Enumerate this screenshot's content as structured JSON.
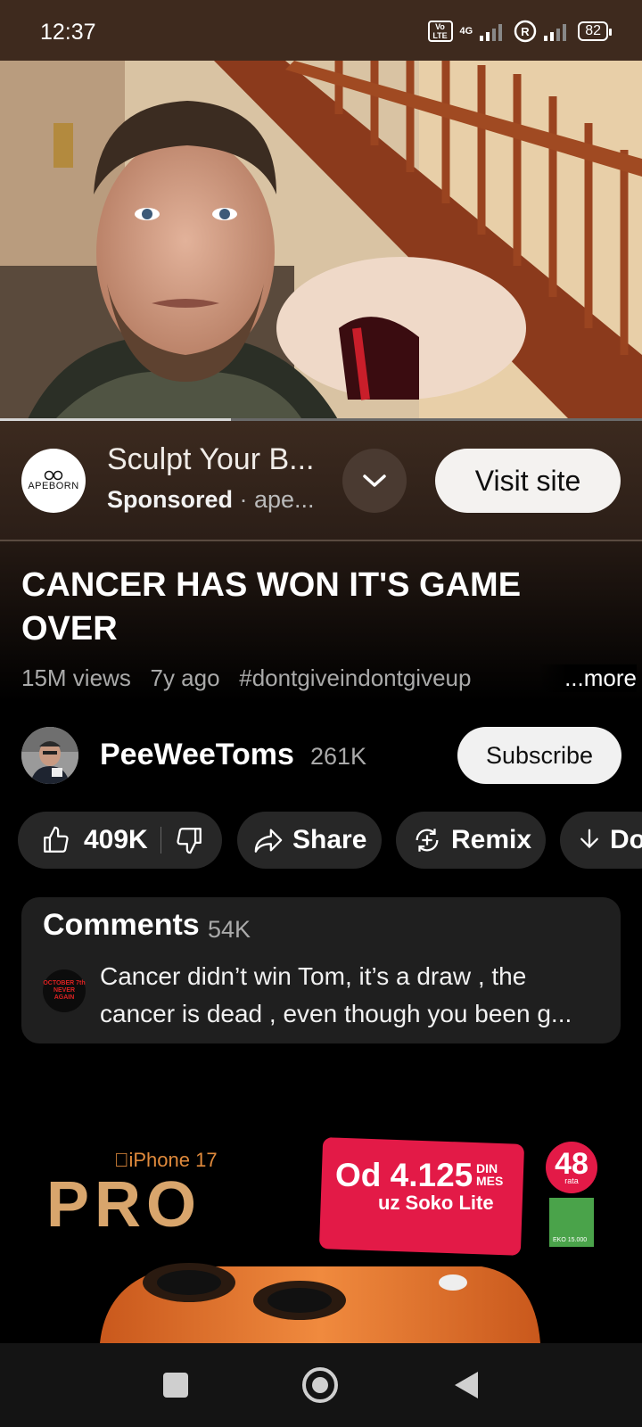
{
  "status_bar": {
    "time": "12:37",
    "volte": "Vo LTE",
    "network": "4G",
    "battery": "82"
  },
  "video": {
    "progress": 0.36
  },
  "ad": {
    "logo_text": "APEBORN",
    "title": "Sculpt Your B...",
    "sponsored": "Sponsored",
    "domain": " · ape...",
    "visit_label": "Visit site"
  },
  "title": "CANCER HAS WON IT'S GAME OVER",
  "meta": {
    "views": "15M views",
    "age": "7y ago",
    "hashtag": "#dontgiveindontgiveup",
    "more": "...more"
  },
  "channel": {
    "name": "PeeWeeToms",
    "subscribers": "261K",
    "subscribe_label": "Subscribe"
  },
  "actions": {
    "likes": "409K",
    "share": "Share",
    "remix": "Remix",
    "download": "Do"
  },
  "comments": {
    "heading": "Comments",
    "count": "54K",
    "avatar_text": "OCTOBER 7th NEVER AGAIN",
    "top_comment": "Cancer didn’t win Tom, it’s a draw , the cancer is dead , even though you been g..."
  },
  "banner": {
    "brand": "iPhone 17",
    "model": "PRO",
    "price": "Od 4.125",
    "currency": "DIN",
    "per": "MES",
    "plan": "uz Soko Lite",
    "rate_count": "48",
    "rate_label": "rata",
    "eco_text": "EKO 15.000"
  },
  "icons": [
    "like-icon",
    "dislike-icon",
    "share-icon",
    "remix-icon",
    "download-icon",
    "chevron-down-icon",
    "nav-recents-icon",
    "nav-home-icon",
    "nav-back-icon"
  ]
}
